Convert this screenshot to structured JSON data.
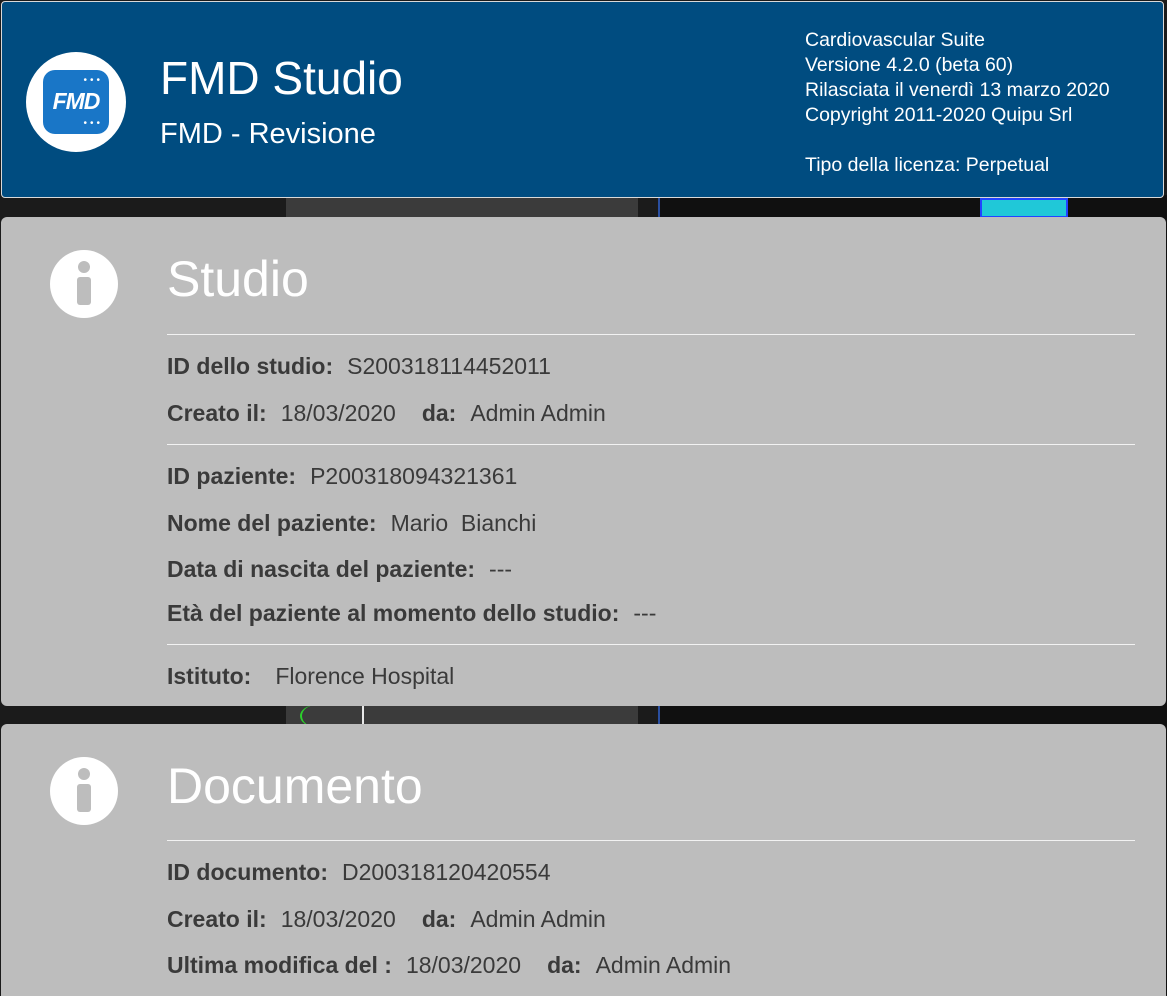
{
  "header": {
    "app_title": "FMD Studio",
    "app_subtitle": "FMD - Revisione",
    "logo_text": "FMD",
    "suite": "Cardiovascular Suite",
    "version": "Versione 4.2.0 (beta 60)",
    "release": "Rilasciata il venerdì 13 marzo 2020",
    "copyright": "Copyright 2011-2020 Quipu Srl",
    "license": "Tipo della licenza: Perpetual",
    "background_color": "#004c80"
  },
  "study": {
    "title": "Studio",
    "icon": "info-icon",
    "id_label": "ID dello studio:",
    "id_value": "S200318114452011",
    "created_label": "Creato il:",
    "created_value": "18/03/2020",
    "by_label": "da:",
    "by_value": "Admin Admin",
    "patient_id_label": "ID paziente:",
    "patient_id_value": "P200318094321361",
    "patient_name_label": "Nome del paziente:",
    "patient_name_value": "Mario  Bianchi",
    "birth_label": "Data di nascita del paziente:",
    "birth_value": "---",
    "age_label": "Età del paziente al momento dello studio:",
    "age_value": "---",
    "institute_label": "Istituto:",
    "institute_value": "Florence Hospital"
  },
  "document": {
    "title": "Documento",
    "icon": "info-icon",
    "id_label": "ID documento:",
    "id_value": "D200318120420554",
    "created_label": "Creato il:",
    "created_value": "18/03/2020",
    "by_label": "da:",
    "by_value": "Admin Admin",
    "modified_label": "Ultima modifica del :",
    "modified_value": "18/03/2020",
    "modified_by_label": "da:",
    "modified_by_value": "Admin Admin"
  },
  "colors": {
    "panel_background": "#bdbdbd",
    "header_background": "#004c80",
    "logo_tile": "#1976c7"
  }
}
